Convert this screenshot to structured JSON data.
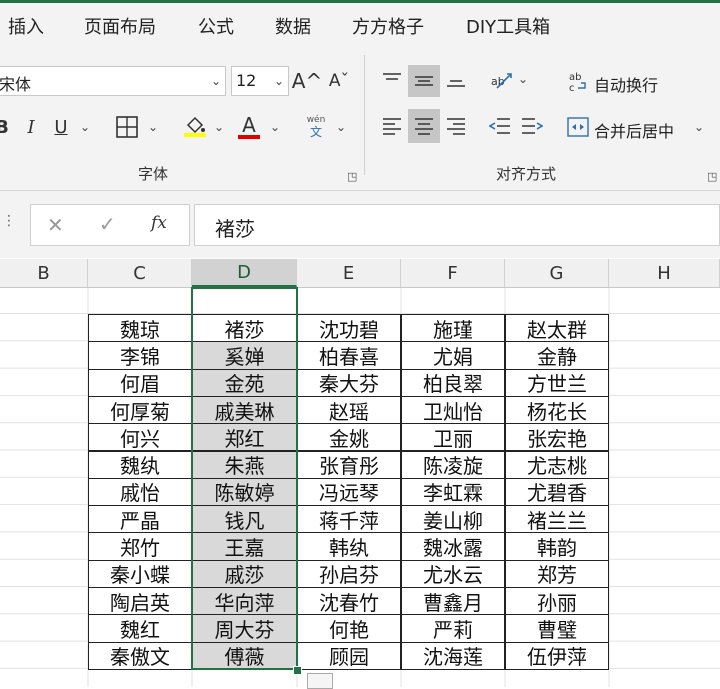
{
  "ribbon_tabs": [
    "插入",
    "页面布局",
    "公式",
    "数据",
    "方方格子",
    "DIY工具箱"
  ],
  "font": {
    "name": "宋体",
    "size": "12",
    "grow_icon": "A^",
    "shrink_icon": "Aˇ",
    "bold": "B",
    "italic": "I",
    "underline": "U",
    "phonetic_top": "wén",
    "phonetic_bottom": "文",
    "group_label": "字体",
    "highlight_color": "#ffff00",
    "font_color": "#e00000"
  },
  "alignment": {
    "wrap_text_label": "自动换行",
    "merge_center_label": "合并后居中",
    "group_label": "对齐方式"
  },
  "formula_bar": {
    "cancel_icon": "✕",
    "enter_icon": "✓",
    "fx_icon": "fx",
    "content": "褚莎"
  },
  "columns": [
    "B",
    "C",
    "D",
    "E",
    "F",
    "G",
    "H"
  ],
  "selected_column": "D",
  "table": [
    [
      "魏琼",
      "褚莎",
      "沈功碧",
      "施瑾",
      "赵太群"
    ],
    [
      "李锦",
      "奚婵",
      "柏春喜",
      "尤娟",
      "金静"
    ],
    [
      "何眉",
      "金苑",
      "秦大芬",
      "柏良翠",
      "方世兰"
    ],
    [
      "何厚菊",
      "戚美琳",
      "赵瑶",
      "卫灿怡",
      "杨花长"
    ],
    [
      "何兴",
      "郑红",
      "金姚",
      "卫丽",
      "张宏艳"
    ],
    [
      "魏纨",
      "朱燕",
      "张育彤",
      "陈凌旋",
      "尤志桃"
    ],
    [
      "戚怡",
      "陈敏婷",
      "冯远琴",
      "李虹霖",
      "尤碧香"
    ],
    [
      "严晶",
      "钱凡",
      "蒋千萍",
      "姜山柳",
      "褚兰兰"
    ],
    [
      "郑竹",
      "王嘉",
      "韩纨",
      "魏冰露",
      "韩韵"
    ],
    [
      "秦小蝶",
      "戚莎",
      "孙启芬",
      "尤水云",
      "郑芳"
    ],
    [
      "陶启英",
      "华向萍",
      "沈春竹",
      "曹鑫月",
      "孙丽"
    ],
    [
      "魏红",
      "周大芬",
      "何艳",
      "严莉",
      "曹璧"
    ],
    [
      "秦傲文",
      "傅薇",
      "顾园",
      "沈海莲",
      "伍伊萍"
    ]
  ]
}
